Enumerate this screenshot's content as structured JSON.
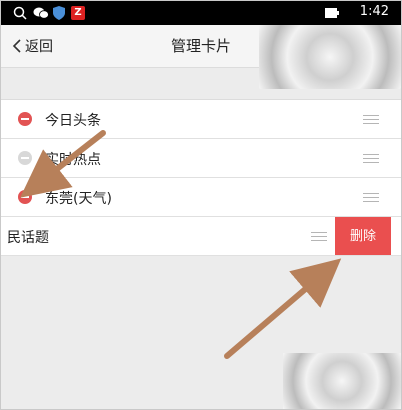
{
  "status_bar": {
    "time": "1:42",
    "app_badge_letter": "Z"
  },
  "header": {
    "back_label": "返回",
    "title": "管理卡片"
  },
  "list": {
    "items": [
      {
        "label": "今日头条",
        "removable": true
      },
      {
        "label": "实时热点",
        "removable": false
      },
      {
        "label": "东莞(天气)",
        "removable": true
      },
      {
        "label": "民话题",
        "removable": true
      }
    ],
    "delete_label": "删除"
  },
  "colors": {
    "accent_red": "#e25353",
    "delete_red": "#ea4f4f",
    "annotation_arrow": "#b7805a"
  },
  "icons": [
    "search-icon",
    "chat-icon",
    "shield-icon",
    "app-icon",
    "battery-icon",
    "back-chevron-icon",
    "remove-icon",
    "drag-handle-icon"
  ]
}
